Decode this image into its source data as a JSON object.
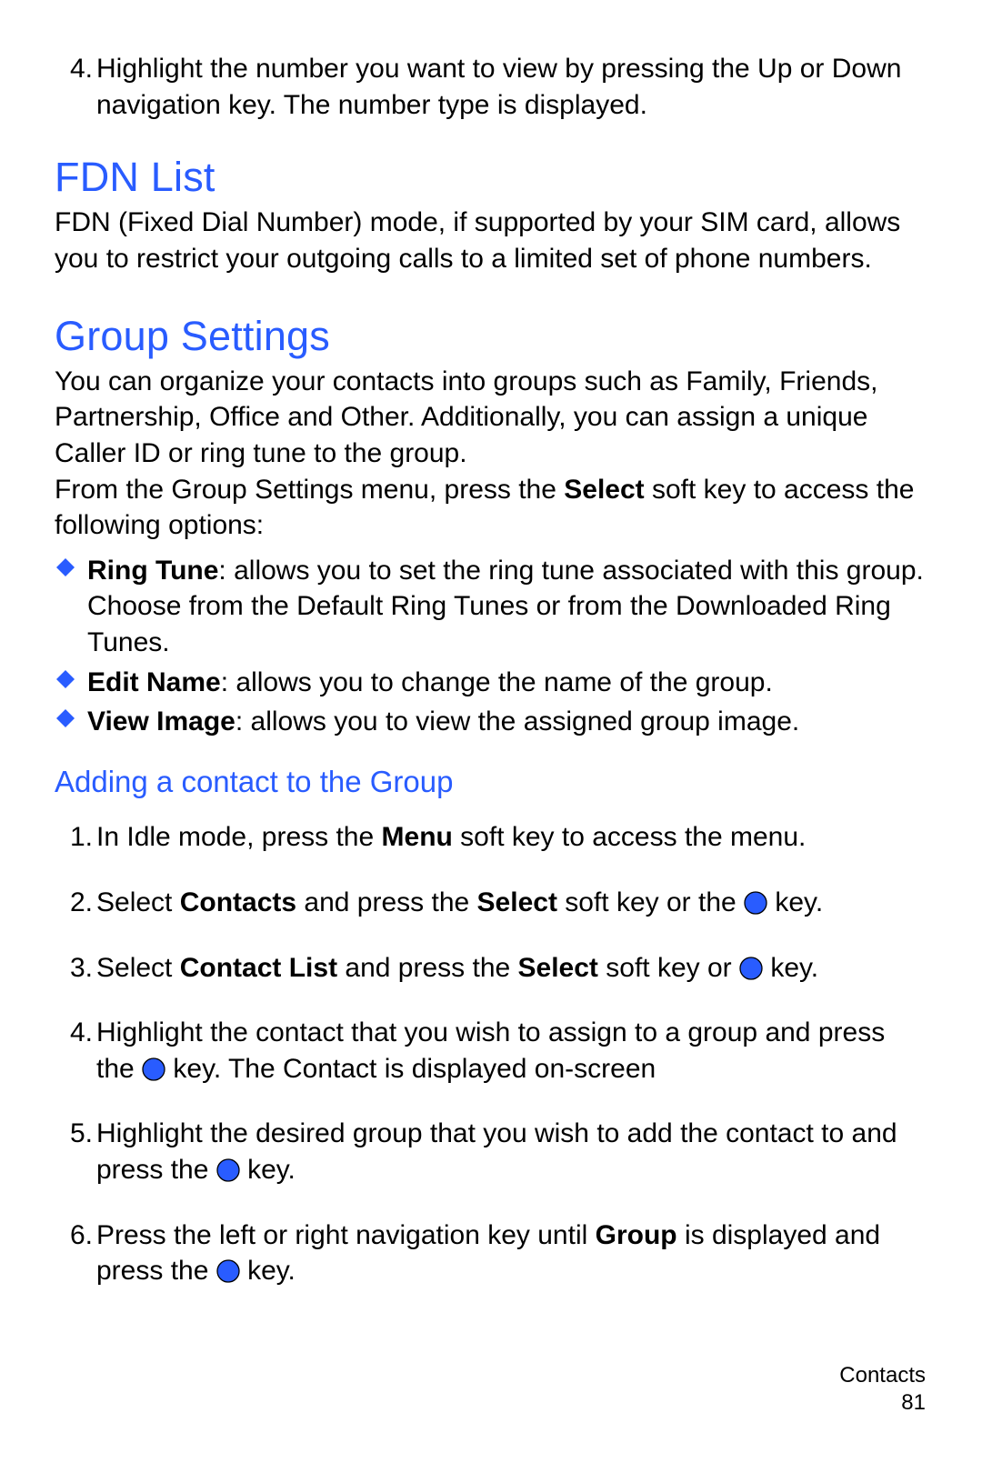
{
  "step4_top": "Highlight the number you want to view by pressing the Up or Down navigation key. The number type is displayed.",
  "fdn": {
    "heading": "FDN List",
    "body": "FDN (Fixed Dial Number) mode, if supported by your SIM card, allows you to restrict your outgoing calls to a limited set of phone numbers."
  },
  "group": {
    "heading": "Group Settings",
    "p1": "You can organize your contacts into groups such as Family, Friends, Partnership, Office and Other. Additionally, you can assign a unique Caller ID or ring tune to the group.",
    "p2_a": "From the Group Settings menu, press the ",
    "p2_bold": "Select",
    "p2_b": " soft key to access the following options:",
    "bullets": [
      {
        "label": "Ring Tune",
        "text": ": allows you to set the ring tune associated with this group. Choose from the Default Ring Tunes or from the Downloaded Ring Tunes."
      },
      {
        "label": "Edit Name",
        "text": ": allows you to change the name of the group."
      },
      {
        "label": "View Image",
        "text": ": allows you to view the assigned group image."
      }
    ],
    "sub_heading": "Adding a contact to the Group",
    "steps": {
      "s1_a": "In Idle mode, press the ",
      "s1_bold": "Menu",
      "s1_b": " soft key to access the menu.",
      "s2_a": "Select ",
      "s2_bold1": "Contacts",
      "s2_b": " and press the ",
      "s2_bold2": "Select",
      "s2_c": " soft key or the ",
      "s2_d": " key.",
      "s3_a": "Select ",
      "s3_bold1": "Contact List",
      "s3_b": " and press the ",
      "s3_bold2": "Select",
      "s3_c": " soft key or ",
      "s3_d": " key.",
      "s4_a": "Highlight the contact that you wish to assign to a group and press the ",
      "s4_b": " key. The Contact is displayed on-screen",
      "s5_a": "Highlight the desired group that you wish to add the contact to and press the ",
      "s5_b": " key.",
      "s6_a": "Press the left or right navigation key until ",
      "s6_bold": "Group",
      "s6_b": " is displayed and press the ",
      "s6_c": " key."
    }
  },
  "footer": {
    "section": "Contacts",
    "page": "81"
  }
}
